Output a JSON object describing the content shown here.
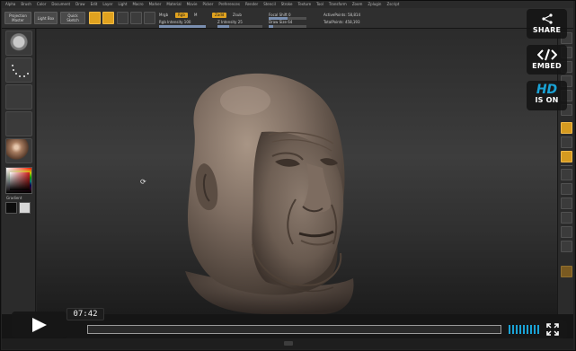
{
  "menu": {
    "items": [
      "Alpha",
      "Brush",
      "Color",
      "Document",
      "Draw",
      "Edit",
      "Layer",
      "Light",
      "Macro",
      "Marker",
      "Material",
      "Movie",
      "Picker",
      "Preferences",
      "Render",
      "Stencil",
      "Stroke",
      "Texture",
      "Tool",
      "Transform",
      "Zoom",
      "Zplugin",
      "Zscript"
    ]
  },
  "toolshelf": {
    "projection_master": "Projection Master",
    "lightbox": "Light Box",
    "quick_sketch": "Quick Sketch",
    "mrgb_label": "Mrgb",
    "rgb_label": "Rgb",
    "m_label": "M",
    "zadd_label": "Zadd",
    "zsub_label": "Zsub",
    "rgb_intensity_label": "Rgb Intensity 100",
    "z_intensity_label": "Z Intensity 25",
    "focal_shift_label": "Focal Shift 0",
    "draw_size_label": "Draw Size 64",
    "active_points": "ActivePoints: 58,814",
    "total_points": "TotalPoints: 458,193"
  },
  "left_palette": {
    "gradient_label": "Gradient"
  },
  "overlay": {
    "share_label": "SHARE",
    "embed_label": "EMBED",
    "hd_mark": "HD",
    "hd_label": "IS ON"
  },
  "player": {
    "time": "07:42",
    "progress": 0.0
  },
  "colors": {
    "accent_blue": "#1aa3d6",
    "zbrush_orange": "#e0a21f",
    "clay": "#7d6d61"
  },
  "icons": {
    "share": "share-icon",
    "embed": "code-brackets-icon",
    "play": "play-icon",
    "volume": "volume-icon",
    "fullscreen": "fullscreen-icon",
    "cursor": "rotate-cursor-icon"
  }
}
